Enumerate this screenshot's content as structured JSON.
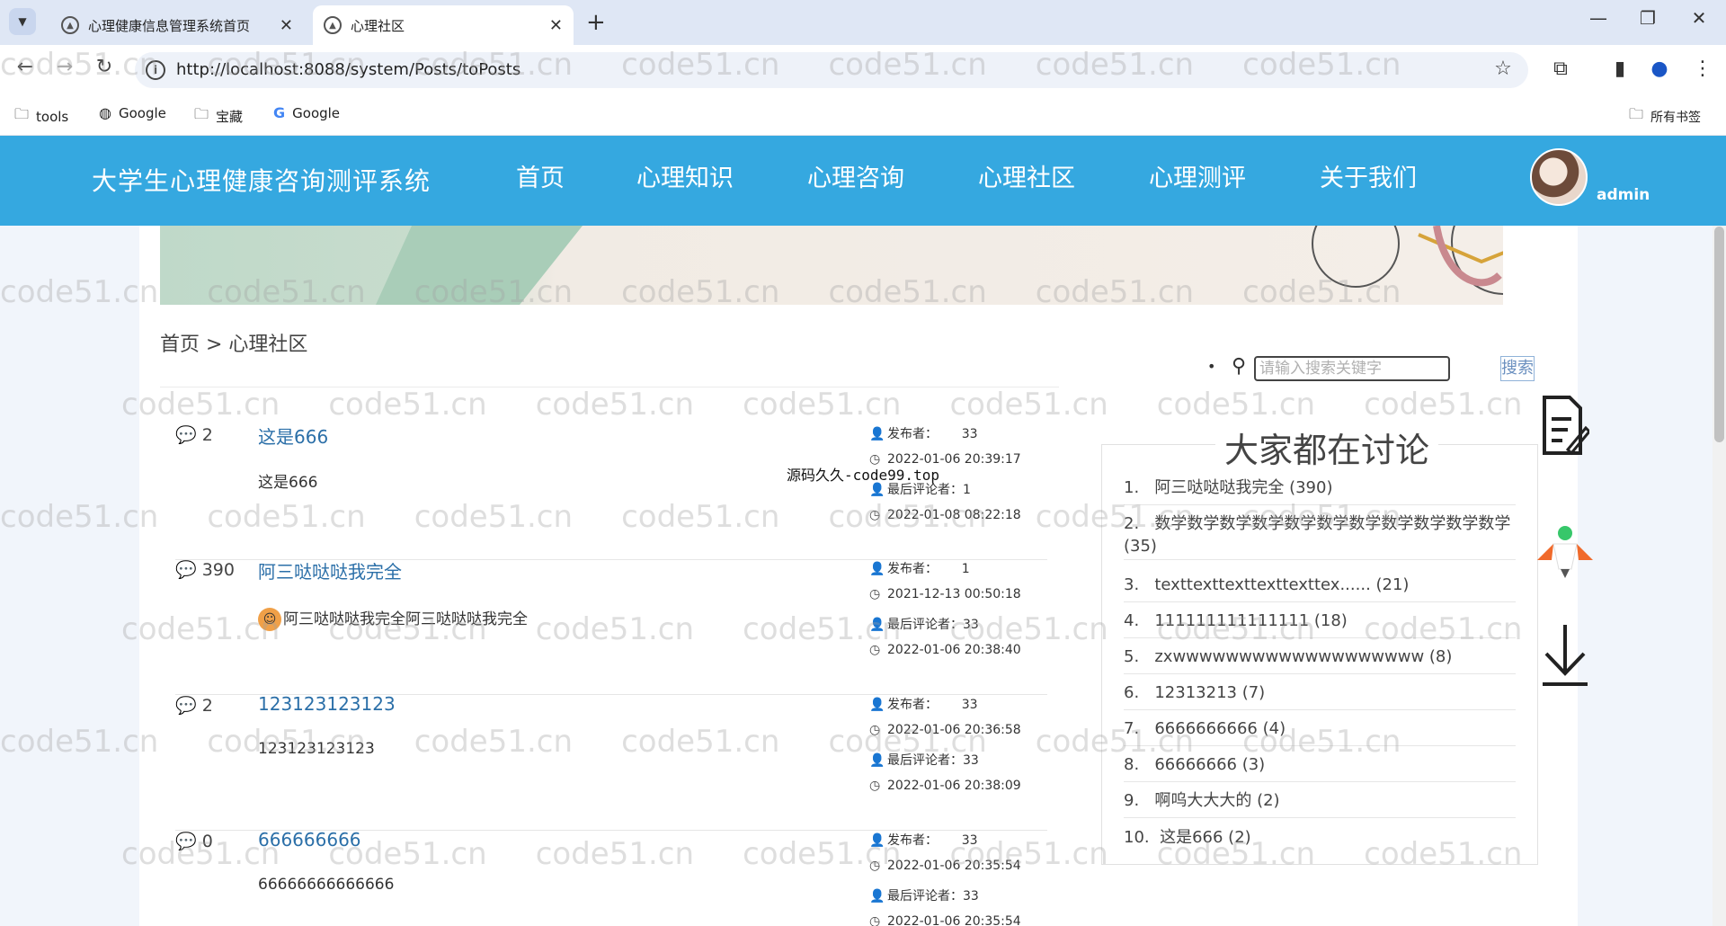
{
  "browser": {
    "tabs": [
      {
        "title": "心理健康信息管理系统首页"
      },
      {
        "title": "心理社区"
      }
    ],
    "url": "http://localhost:8088/system/Posts/toPosts",
    "bookmarks": [
      {
        "label": "tools",
        "icon": "folder-icon"
      },
      {
        "label": "Google",
        "icon": "globe-icon"
      },
      {
        "label": "宝藏",
        "icon": "folder-icon"
      },
      {
        "label": "Google",
        "icon": "google-icon"
      }
    ],
    "bookmarks_right": "所有书签"
  },
  "site": {
    "title": "大学生心理健康咨询测评系统",
    "nav": [
      "首页",
      "心理知识",
      "心理咨询",
      "心理社区",
      "心理测评",
      "关于我们"
    ],
    "username": "admin",
    "header_color": "#35a8e0"
  },
  "breadcrumb": "首页 > 心理社区",
  "overlay_text": "源码久久-code99.top",
  "posts": [
    {
      "comments": "2",
      "title": "这是666",
      "excerpt": "这是666",
      "author_label": "发布者：",
      "author": "33",
      "created": "2022-01-06 20:39:17",
      "last_label": "最后评论者：",
      "last_commenter": "1",
      "last_time": "2022-01-08 08:22:18"
    },
    {
      "comments": "390",
      "title": "阿三哒哒哒我完全",
      "excerpt": "阿三哒哒哒我完全阿三哒哒哒我完全",
      "author_label": "发布者：",
      "author": "1",
      "created": "2021-12-13 00:50:18",
      "last_label": "最后评论者：",
      "last_commenter": "33",
      "last_time": "2022-01-06 20:38:40"
    },
    {
      "comments": "2",
      "title": "123123123123",
      "excerpt": "123123123123",
      "author_label": "发布者：",
      "author": "33",
      "created": "2022-01-06 20:36:58",
      "last_label": "最后评论者：",
      "last_commenter": "33",
      "last_time": "2022-01-06 20:38:09"
    },
    {
      "comments": "0",
      "title": "666666666",
      "excerpt": "66666666666666",
      "author_label": "发布者：",
      "author": "33",
      "created": "2022-01-06 20:35:54",
      "last_label": "最后评论者：",
      "last_commenter": "33",
      "last_time": "2022-01-06 20:35:54"
    }
  ],
  "search": {
    "placeholder": "请输入搜索关键字",
    "button": "搜索"
  },
  "hot": {
    "title": "大家都在讨论",
    "items": [
      {
        "rank": "1.",
        "text": "阿三哒哒哒我完全  (390)"
      },
      {
        "rank": "2.",
        "text": "数学数学数学数学数学数学数学数学数学数学数学  (35)"
      },
      {
        "rank": "3.",
        "text": "texttexttexttexttexttex......  (21)"
      },
      {
        "rank": "4.",
        "text": "111111111111111  (18)"
      },
      {
        "rank": "5.",
        "text": "zxwwwwwwwwwwwwwwwwwww  (8)"
      },
      {
        "rank": "6.",
        "text": "12313213  (7)"
      },
      {
        "rank": "7.",
        "text": "6666666666  (4)"
      },
      {
        "rank": "8.",
        "text": "66666666  (3)"
      },
      {
        "rank": "9.",
        "text": "啊呜大大大的  (2)"
      },
      {
        "rank": "10.",
        "text": "这是666  (2)"
      }
    ]
  },
  "watermark": "code51.cn"
}
